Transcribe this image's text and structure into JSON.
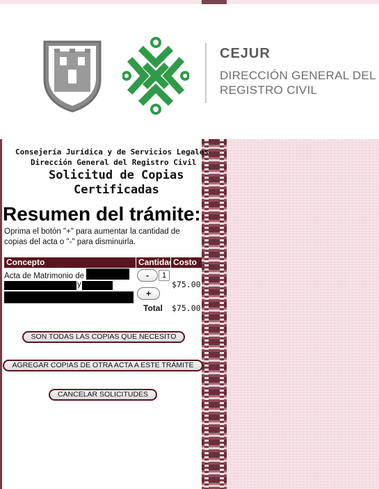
{
  "header": {
    "brand": "CEJUR",
    "department_line1": "DIRECCIÓN GENERAL DEL",
    "department_line2": "REGISTRO CIVIL"
  },
  "form": {
    "org_line1": "Consejería Jurídica y de Servicios Legales",
    "org_line2": "Dirección General del Registro Civil",
    "heading_line1": "Solicitud de Copias",
    "heading_line2": "Certificadas",
    "title": "Resumen del trámite:",
    "instructions": "Oprima el botón \"+\" para aumentar la cantidad de copias del acta o \"-\" para disminuirla.",
    "table": {
      "headers": [
        "Concepto",
        "Cantidad",
        "Costo"
      ],
      "rows": [
        {
          "concept_prefix": "Acta de Matrimonio de",
          "concept_joiner": "y",
          "quantity": "1",
          "cost": "$75.00",
          "decrement_label": "-",
          "increment_label": "+"
        }
      ],
      "total_label": "Total",
      "total_value": "$75.00"
    },
    "buttons": {
      "done": "SON TODAS LAS COPIAS QUE NECESITO",
      "add_other": "AGREGAR COPIAS DE OTRA ACTA A ESTE TRÁMITE",
      "cancel": "CANCELAR SOLICITUDES"
    }
  },
  "colors": {
    "header_bar": "#5b1420",
    "logo_green": "#2f9a47",
    "shield_gray": "#7d7d7d",
    "pink_panel": "#f4dde3"
  }
}
